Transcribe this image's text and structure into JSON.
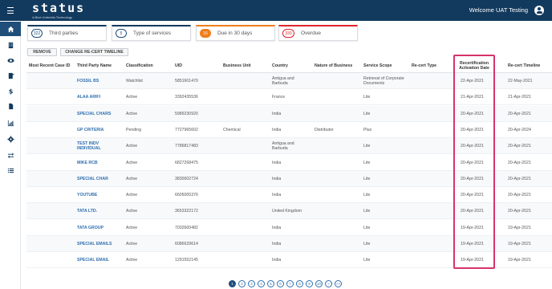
{
  "header": {
    "logo_text": "status",
    "tagline": "A Blue Umbrella Technology",
    "welcome": "Welcome UAT Testing"
  },
  "sidebar": {
    "items": [
      {
        "icon": "home-icon"
      },
      {
        "icon": "building-icon"
      },
      {
        "icon": "eye-icon"
      },
      {
        "icon": "document-icon"
      },
      {
        "icon": "dollar-icon"
      },
      {
        "icon": "file-icon"
      },
      {
        "icon": "chart-icon"
      },
      {
        "icon": "gear-icon"
      },
      {
        "icon": "transfer-icon"
      },
      {
        "icon": "list-icon"
      }
    ]
  },
  "cards": [
    {
      "count": "322",
      "label": "Third parties",
      "color": "#123a5e"
    },
    {
      "count": "5",
      "label": "Type of services",
      "color": "#123a5e"
    },
    {
      "count": "16",
      "label": "Due in 30 days",
      "color": "#f07d1a"
    },
    {
      "count": "333",
      "label": "Overdue",
      "color": "#e0242b"
    }
  ],
  "actions": {
    "remove": "REMOVE",
    "change_timeline": "CHANGE RE-CERT TIMELINE"
  },
  "table": {
    "headers": {
      "case_id": "Most Recent Case ID",
      "name": "Third Party Name",
      "classification": "Classification",
      "uid": "UID",
      "business_unit": "Business Unit",
      "country": "Country",
      "nature": "Nature of Business",
      "scope": "Service Scope",
      "recert_type": "Re-cert Type",
      "activation": "Recertification Activation Date",
      "timeline": "Re-cert Timeline"
    },
    "rows": [
      {
        "name": "FOSSIL BS",
        "classification": "Watchlist",
        "uid": "5851601470",
        "business_unit": "",
        "country": "Antigua and Barbuda",
        "nature": "",
        "scope": "Retrieval of Corporate Documents",
        "activation": "22-Apr-2021",
        "timeline": "22-May-2021"
      },
      {
        "name": "ALAA ARIFI",
        "classification": "Active",
        "uid": "3392435536",
        "business_unit": "",
        "country": "France",
        "nature": "",
        "scope": "Lite",
        "activation": "21-Apr-2021",
        "timeline": "21-Apr-2021"
      },
      {
        "name": "SPECIAL CHARS",
        "classification": "Active",
        "uid": "5989230920",
        "business_unit": "",
        "country": "India",
        "nature": "",
        "scope": "Lite",
        "activation": "20-Apr-2021",
        "timeline": "20-Apr-2021"
      },
      {
        "name": "GP CRITERIA",
        "classification": "Pending",
        "uid": "7727965602",
        "business_unit": "Chemical",
        "country": "India",
        "nature": "Distributor",
        "scope": "Plus",
        "activation": "20-Apr-2021",
        "timeline": "20-Apr-2024"
      },
      {
        "name": "TEST INDV INDIVIDUAL",
        "classification": "Active",
        "uid": "7786817483",
        "business_unit": "",
        "country": "Antigua and Barbuda",
        "nature": "",
        "scope": "Lite",
        "activation": "20-Apr-2021",
        "timeline": "20-Apr-2021"
      },
      {
        "name": "MIKE RCB",
        "classification": "Active",
        "uid": "6827268475",
        "business_unit": "",
        "country": "India",
        "nature": "",
        "scope": "Lite",
        "activation": "20-Apr-2021",
        "timeline": "20-Apr-2021"
      },
      {
        "name": "SPECIAL CHAR",
        "classification": "Active",
        "uid": "3830002724",
        "business_unit": "",
        "country": "India",
        "nature": "",
        "scope": "Lite",
        "activation": "20-Apr-2021",
        "timeline": "20-Apr-2021"
      },
      {
        "name": "YOUTUBE",
        "classification": "Active",
        "uid": "6605005376",
        "business_unit": "",
        "country": "India",
        "nature": "",
        "scope": "Lite",
        "activation": "20-Apr-2021",
        "timeline": "20-Apr-2021"
      },
      {
        "name": "TATA LTD.",
        "classification": "Active",
        "uid": "3653322172",
        "business_unit": "",
        "country": "United Kingdom",
        "nature": "",
        "scope": "Lite",
        "activation": "20-Apr-2021",
        "timeline": "20-Apr-2021"
      },
      {
        "name": "TATA GROUP",
        "classification": "Active",
        "uid": "7032600482",
        "business_unit": "",
        "country": "India",
        "nature": "",
        "scope": "Lite",
        "activation": "19-Apr-2021",
        "timeline": "19-Apr-2021"
      },
      {
        "name": "SPECIAL EMAILS",
        "classification": "Active",
        "uid": "6086629614",
        "business_unit": "",
        "country": "India",
        "nature": "",
        "scope": "Lite",
        "activation": "19-Apr-2021",
        "timeline": "19-Apr-2021"
      },
      {
        "name": "SPECIAL EMAIL",
        "classification": "Active",
        "uid": "1291552145",
        "business_unit": "",
        "country": "India",
        "nature": "",
        "scope": "Lite",
        "activation": "19-Apr-2021",
        "timeline": "19-Apr-2021"
      }
    ]
  },
  "pagination": {
    "pages": [
      "1",
      "2",
      "3",
      "4",
      "5",
      "6",
      "7",
      "8",
      "9",
      "10",
      "»",
      "»»"
    ],
    "current": "1"
  }
}
